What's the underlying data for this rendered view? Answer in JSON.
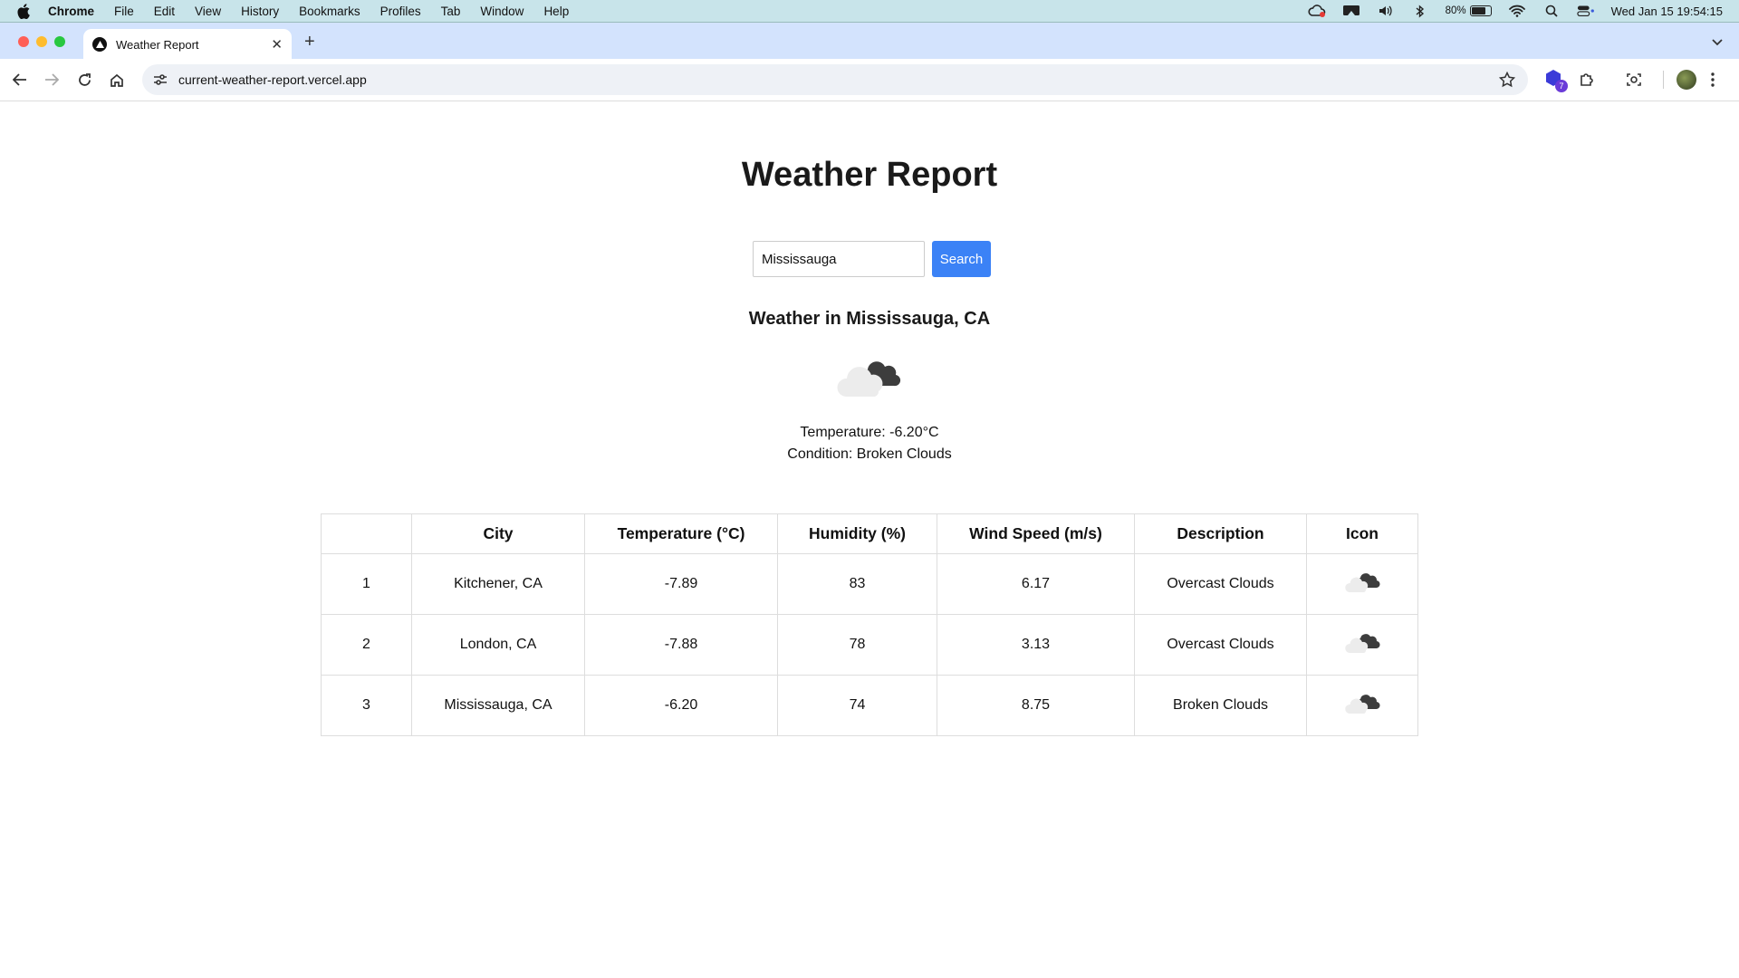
{
  "menubar": {
    "app_name": "Chrome",
    "menus": [
      "File",
      "Edit",
      "View",
      "History",
      "Bookmarks",
      "Profiles",
      "Tab",
      "Window",
      "Help"
    ],
    "battery_percent": "80%",
    "datetime": "Wed Jan 15  19:54:15"
  },
  "browser": {
    "tab_title": "Weather Report",
    "url": "current-weather-report.vercel.app",
    "extension_badge": "7"
  },
  "page": {
    "title": "Weather Report",
    "search": {
      "value": "Mississauga",
      "button_label": "Search"
    },
    "current": {
      "heading": "Weather in Mississauga, CA",
      "icon": "broken-clouds-icon",
      "temperature_line": "Temperature: -6.20°C",
      "condition_line": "Condition: Broken Clouds"
    },
    "table": {
      "headers": [
        "",
        "City",
        "Temperature (°C)",
        "Humidity (%)",
        "Wind Speed (m/s)",
        "Description",
        "Icon"
      ],
      "rows": [
        {
          "index": "1",
          "city": "Kitchener, CA",
          "temperature": "-7.89",
          "humidity": "83",
          "wind": "6.17",
          "description": "Overcast Clouds",
          "icon": "overcast-clouds-icon"
        },
        {
          "index": "2",
          "city": "London, CA",
          "temperature": "-7.88",
          "humidity": "78",
          "wind": "3.13",
          "description": "Overcast Clouds",
          "icon": "overcast-clouds-icon"
        },
        {
          "index": "3",
          "city": "Mississauga, CA",
          "temperature": "-6.20",
          "humidity": "74",
          "wind": "8.75",
          "description": "Broken Clouds",
          "icon": "broken-clouds-icon"
        }
      ]
    }
  },
  "colors": {
    "menubar_bg": "#c8e4ea",
    "tabstrip_bg": "#d3e3fd",
    "search_button": "#3b82f6",
    "table_border": "#dddddd"
  }
}
